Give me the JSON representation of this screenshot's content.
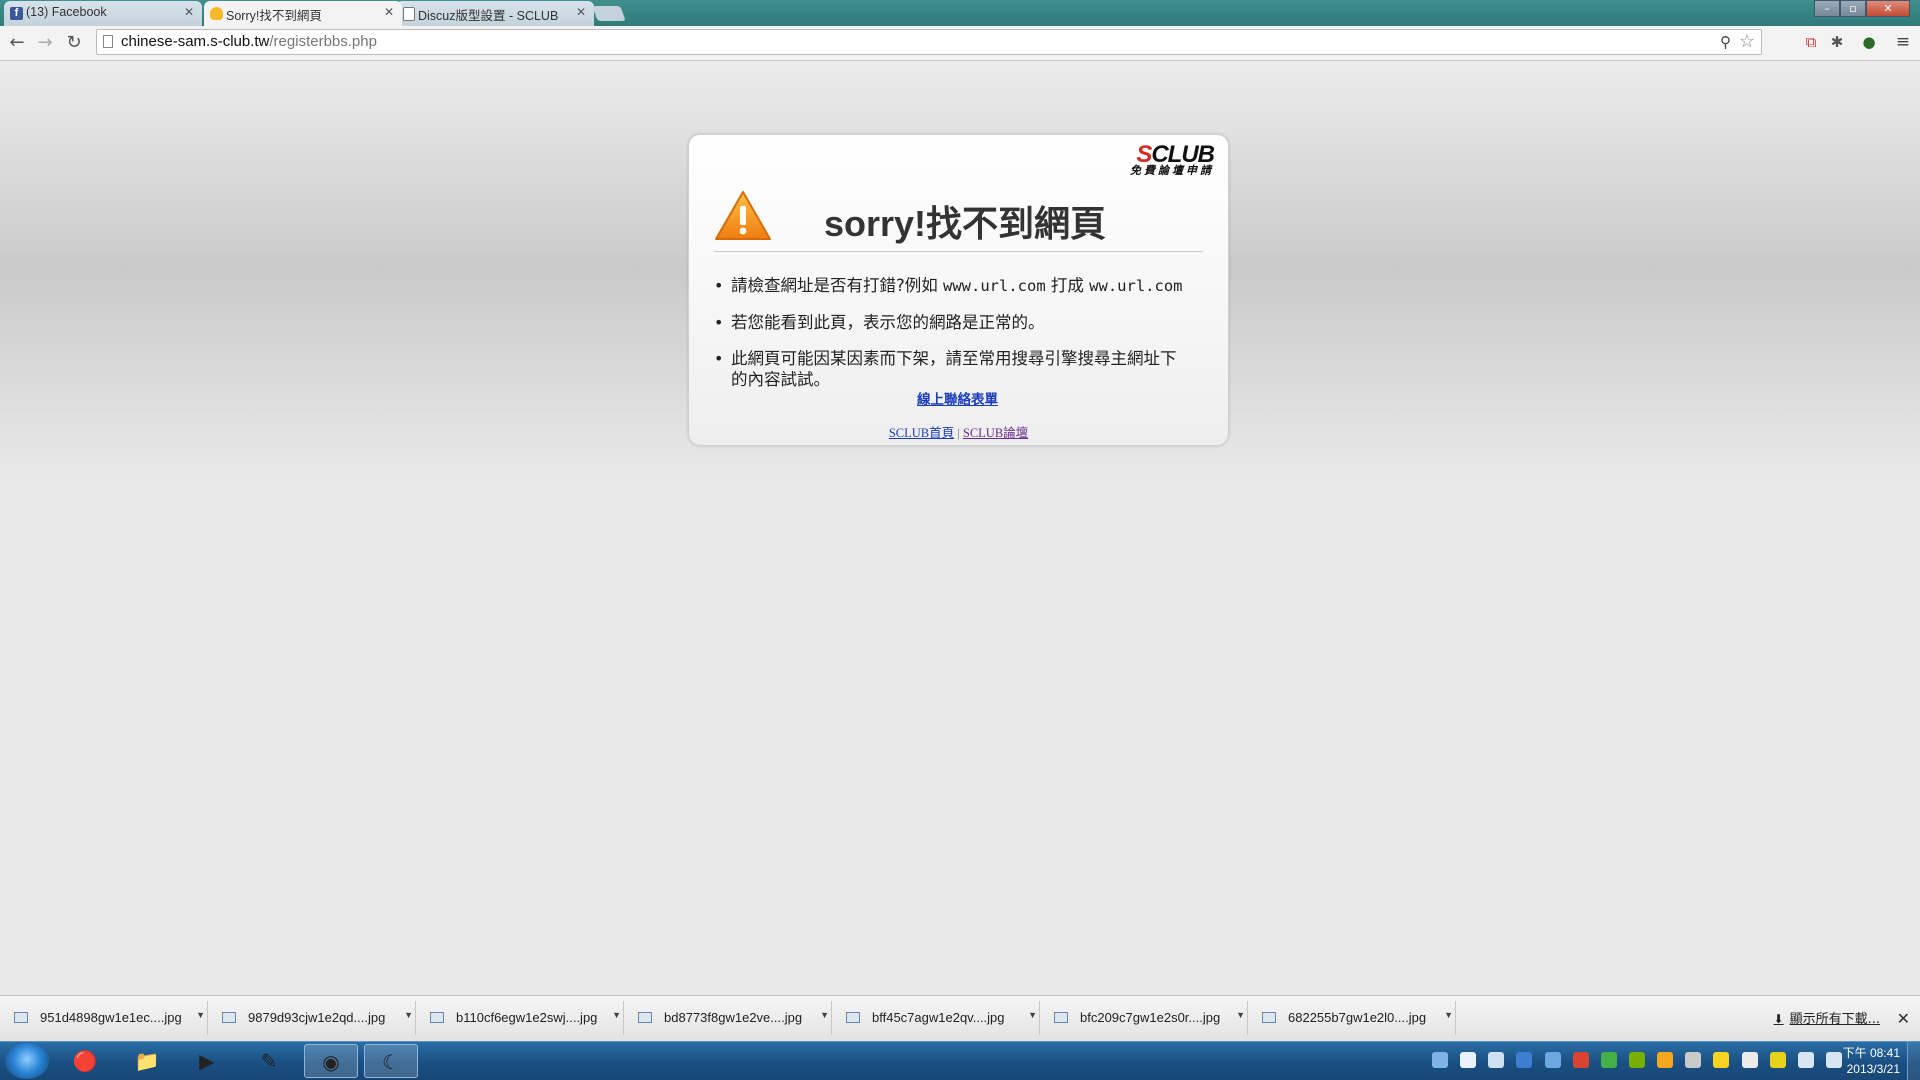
{
  "browser": {
    "tabs": [
      {
        "title": "(13) Facebook",
        "icon": "facebook-icon"
      },
      {
        "title": "Sorry!找不到網頁",
        "icon": "sclub-icon"
      },
      {
        "title": "Discuz版型設置 - SCLUB",
        "icon": "document-icon"
      }
    ],
    "address": {
      "host": "chinese-sam.s-club.tw",
      "path": "/registerbbs.php"
    }
  },
  "page": {
    "logo": {
      "brand_s": "S",
      "brand_rest": "CLUB",
      "tagline": "免費論壇申請"
    },
    "title": "sorry!找不到網頁",
    "bullets": [
      {
        "text_a": "請檢查網址是否有打錯?例如 ",
        "code_a": "www.url.com",
        "text_b": " 打成 ",
        "code_b": "ww.url.com"
      },
      {
        "text": "若您能看到此頁，表示您的網路是正常的。"
      },
      {
        "text": "此網頁可能因某因素而下架，請至常用搜尋引擎搜尋主網址下的內容試試。"
      }
    ],
    "contact_link": "線上聯絡表單",
    "footer": {
      "home": "SCLUB首頁",
      "separator": "|",
      "forum": "SCLUB論壇"
    }
  },
  "downloads": {
    "items": [
      "951d4898gw1e1ec....jpg",
      "9879d93cjw1e2qd....jpg",
      "b110cf6egw1e2swj....jpg",
      "bd8773f8gw1e2ve....jpg",
      "bff45c7agw1e2qv....jpg",
      "bfc209c7gw1e2s0r....jpg",
      "682255b7gw1e2l0....jpg"
    ],
    "show_all": "顯示所有下載..."
  },
  "taskbar": {
    "time": "下午 08:41",
    "date": "2013/3/21"
  },
  "colors": {
    "link": "#1a3dbb",
    "warning": "#f39b1f",
    "brand_red": "#d42b1e"
  }
}
